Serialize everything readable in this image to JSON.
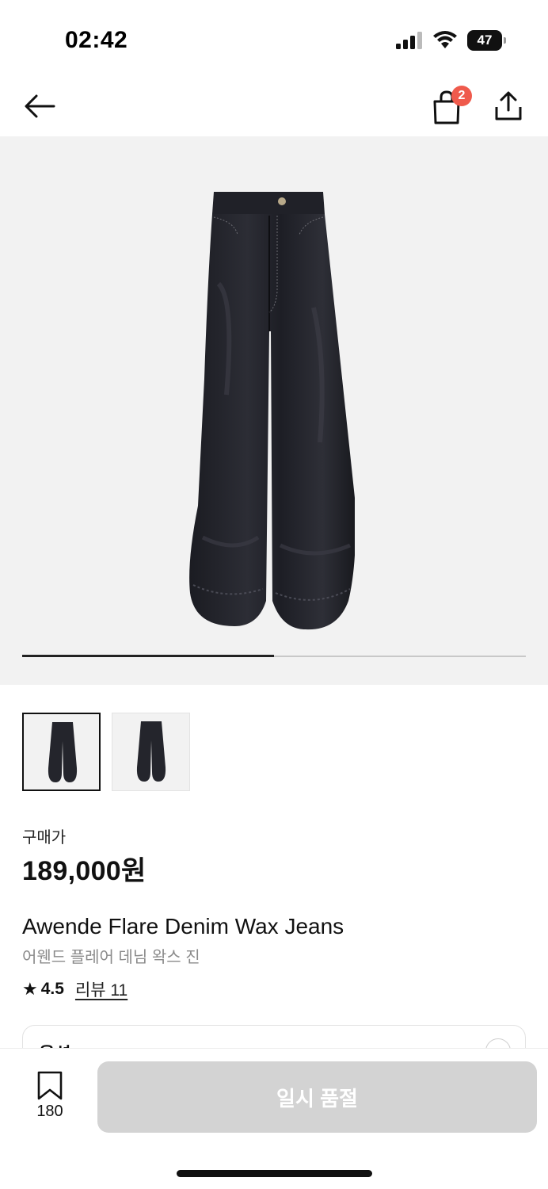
{
  "status_bar": {
    "time": "02:42",
    "battery": "47"
  },
  "nav": {
    "cart_badge": "2"
  },
  "gallery": {
    "image_count": 2,
    "current_index": 1,
    "progress_fraction": 0.5
  },
  "product": {
    "price_label": "구매가",
    "price": "189,000원",
    "name": "Awende Flare Denim Wax Jeans",
    "name_ko": "어웬드 플레어 데님 왁스 진",
    "rating": "4.5",
    "review_link": "리뷰 11"
  },
  "option": {
    "label": "옵션"
  },
  "bottom": {
    "wish_count": "180",
    "cta_label": "일시 품절"
  },
  "colors": {
    "badge": "#ef5a4c",
    "cta_disabled": "#d3d3d3",
    "hero_bg": "#f2f2f2"
  }
}
